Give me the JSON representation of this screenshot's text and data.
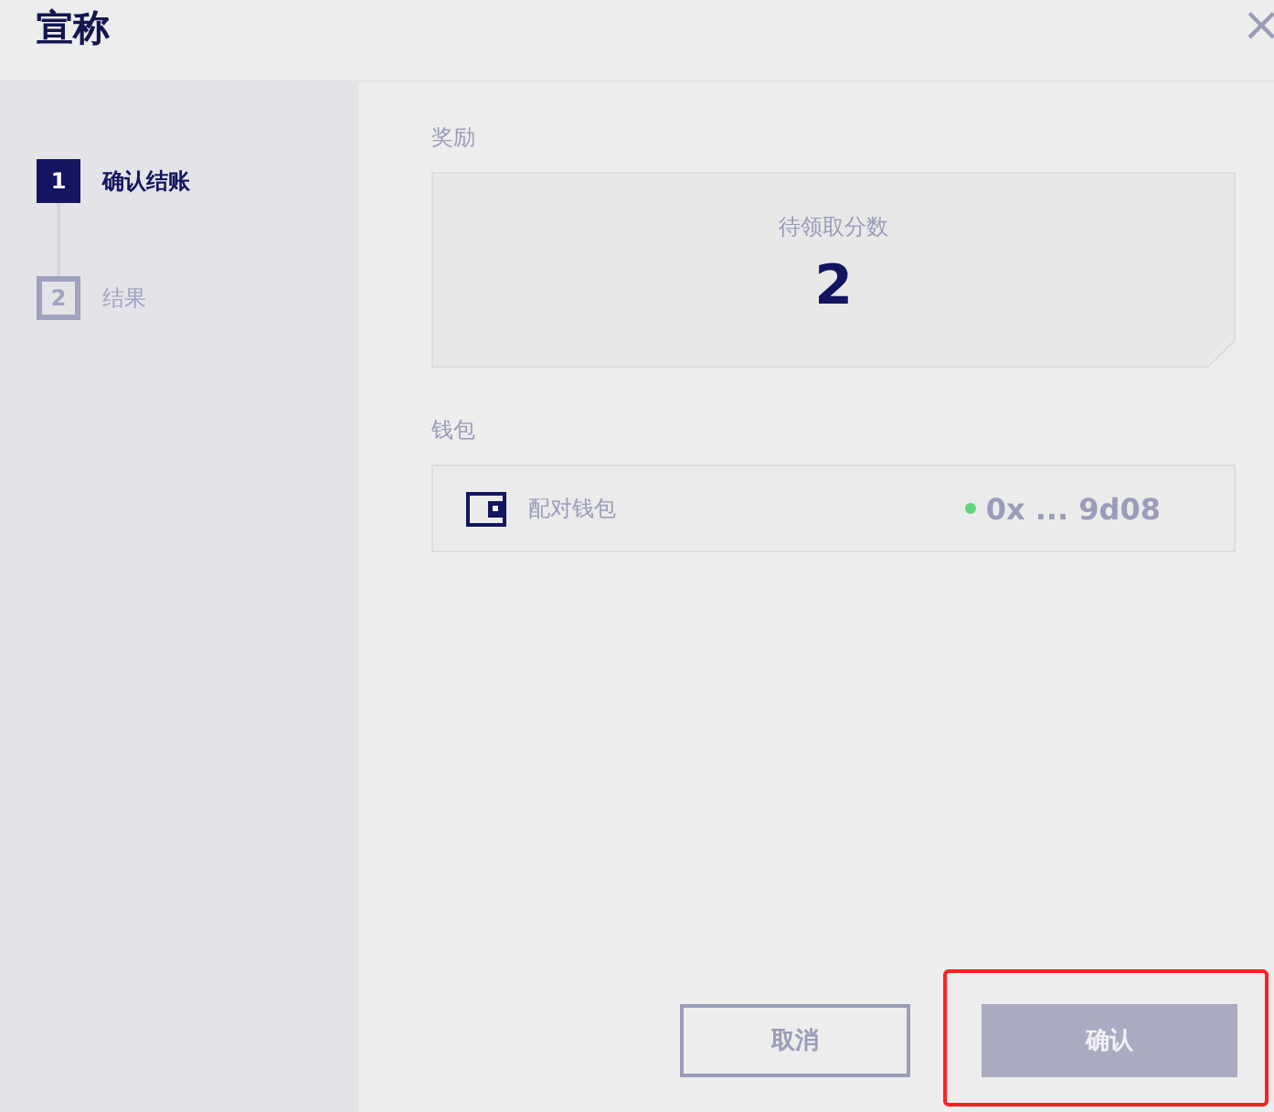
{
  "dialog": {
    "title": "宣称",
    "close": "×"
  },
  "steps": [
    {
      "number": "1",
      "label": "确认结账",
      "selected": true
    },
    {
      "number": "2",
      "label": "结果",
      "selected": false
    }
  ],
  "reward": {
    "heading": "奖励",
    "caption": "待领取分数",
    "value": "2"
  },
  "wallet": {
    "heading": "钱包",
    "label": "配对钱包",
    "connected": true,
    "address": "0x ... 9d08"
  },
  "buttons": [
    {
      "label": "取消",
      "kind": "outline",
      "disabled": false,
      "highlighted": false
    },
    {
      "label": "确认",
      "kind": "primary",
      "disabled": true,
      "highlighted": true
    }
  ]
}
